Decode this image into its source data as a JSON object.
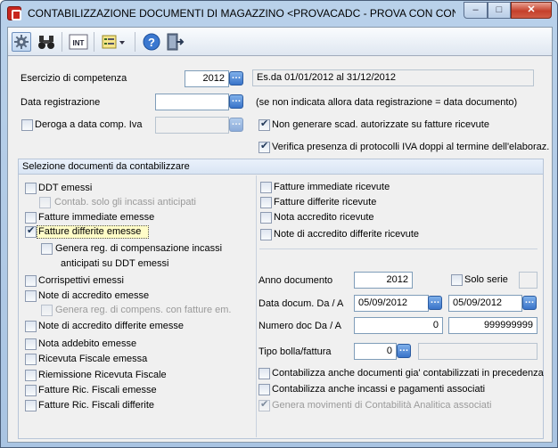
{
  "window": {
    "title": "CONTABILIZZAZIONE DOCUMENTI DI MAGAZZINO <PROVACADC - PROVA CON CONT...",
    "min": "–",
    "max": "□",
    "close": "✕"
  },
  "toolbar": {
    "icons": [
      "gear-icon",
      "binoculars-icon",
      "int-icon",
      "list-dropdown-icon",
      "help-icon",
      "exit-door-icon"
    ],
    "int_label": "INT"
  },
  "header": {
    "esercizio_label": "Esercizio di competenza",
    "esercizio_value": "2012",
    "esercizio_desc": "Es.da 01/01/2012 al 31/12/2012",
    "data_reg_label": "Data registrazione",
    "data_reg_value": "",
    "data_reg_note": "(se non indicata  allora data registrazione = data documento)",
    "deroga_label": "Deroga a data comp. Iva",
    "deroga_checked": false,
    "deroga_value": "",
    "non_gen_label": "Non generare scad. autorizzate su fatture ricevute",
    "non_gen_checked": true,
    "verifica_label": "Verifica presenza di protocolli IVA doppi al termine dell'elaboraz.",
    "verifica_checked": true
  },
  "group": {
    "title": "Selezione documenti da contabilizzare",
    "left": {
      "ddt": "DDT emessi",
      "contab_incassi": "Contab. solo gli incassi anticipati",
      "fatt_imm_emesse": "Fatture immediate emesse",
      "fatt_diff_emesse": "Fatture differite emesse",
      "genera_comp_1": "Genera reg. di compensazione incassi",
      "genera_comp_2": "anticipati su DDT emessi",
      "corrispettivi": "Corrispettivi emessi",
      "note_accr_emesse": "Note di accredito emesse",
      "genera_reg_comp": "Genera reg. di compens. con fatture em.",
      "note_accr_diff_emesse": "Note di accredito differite emesse",
      "nota_addebito": "Nota addebito emesse",
      "ric_fiscale": "Ricevuta Fiscale emessa",
      "riemissione_ric": "Riemissione Ricevuta Fiscale",
      "fatt_ric_fisc_emesse": "Fatture Ric. Fiscali emesse",
      "fatt_ric_fisc_diff": "Fatture Ric. Fiscali differite"
    },
    "right": {
      "fatt_imm_ric": "Fatture immediate ricevute",
      "fatt_diff_ric": "Fatture differite ricevute",
      "nota_accr_ric": "Nota accredito ricevute",
      "note_accr_diff_ric": "Note di accredito differite ricevute",
      "anno_doc_label": "Anno documento",
      "anno_doc_value": "2012",
      "solo_serie_label": "Solo serie",
      "data_doc_label": "Data docum. Da / A",
      "data_da": "05/09/2012",
      "data_a": "05/09/2012",
      "num_doc_label": "Numero doc Da / A",
      "num_da": "0",
      "num_a": "999999999",
      "tipo_bolla_label": "Tipo bolla/fattura",
      "tipo_bolla_value": "0",
      "contab_anche_doc": "Contabilizza anche documenti gia' contabilizzati in precedenza",
      "contab_anche_incassi": "Contabilizza anche incassi e pagamenti associati",
      "genera_mov_analitica": "Genera movimenti di Contabilità Analitica associati"
    }
  }
}
